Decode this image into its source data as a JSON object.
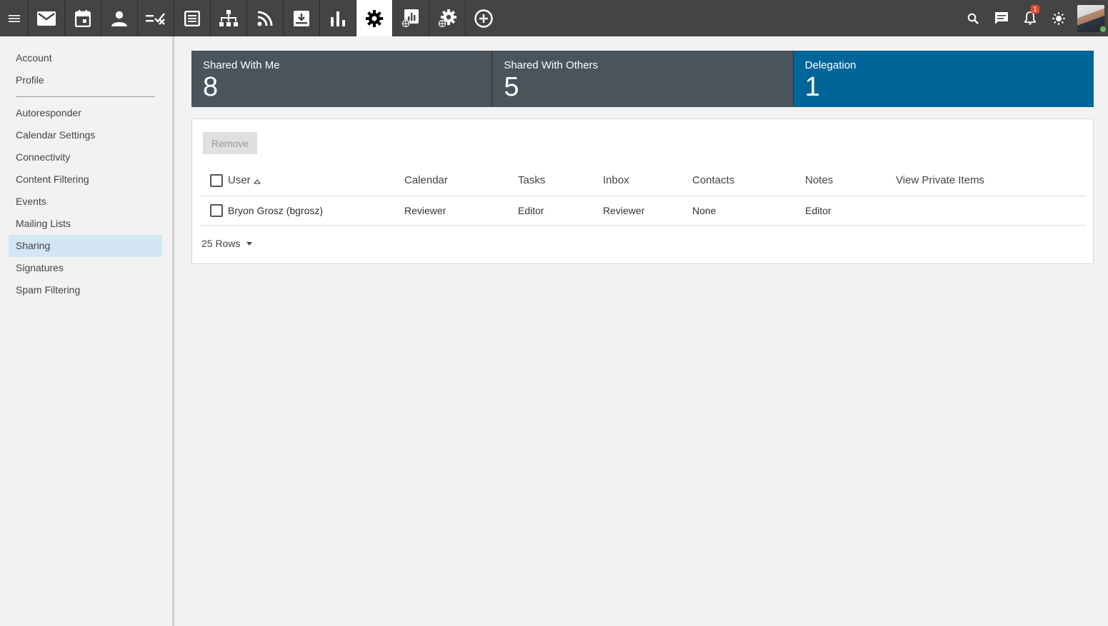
{
  "topbar": {
    "nav_icons": [
      "menu-icon",
      "mail-icon",
      "calendar-icon",
      "contacts-icon",
      "tasks-icon",
      "notes-icon",
      "org-chart-icon",
      "rss-icon",
      "file-storage-icon",
      "reports-icon",
      "settings-icon",
      "domain-reports-icon",
      "domain-settings-icon",
      "add-icon"
    ],
    "active": "settings-icon",
    "notification_count": "1"
  },
  "sidebar": {
    "group1": [
      {
        "label": "Account"
      },
      {
        "label": "Profile"
      }
    ],
    "group2": [
      {
        "label": "Autoresponder"
      },
      {
        "label": "Calendar Settings"
      },
      {
        "label": "Connectivity"
      },
      {
        "label": "Content Filtering"
      },
      {
        "label": "Events"
      },
      {
        "label": "Mailing Lists"
      },
      {
        "label": "Sharing"
      },
      {
        "label": "Signatures"
      },
      {
        "label": "Spam Filtering"
      }
    ],
    "active": "Sharing"
  },
  "cards": [
    {
      "title": "Shared With Me",
      "count": "8"
    },
    {
      "title": "Shared With Others",
      "count": "5"
    },
    {
      "title": "Delegation",
      "count": "1"
    }
  ],
  "toolbar": {
    "remove_label": "Remove"
  },
  "table": {
    "headers": {
      "user": "User",
      "calendar": "Calendar",
      "tasks": "Tasks",
      "inbox": "Inbox",
      "contacts": "Contacts",
      "notes": "Notes",
      "view_private": "View Private Items"
    },
    "rows": [
      {
        "user": "Bryon Grosz (bgrosz)",
        "calendar": "Reviewer",
        "tasks": "Editor",
        "inbox": "Reviewer",
        "contacts": "None",
        "notes": "Editor",
        "view_private": ""
      }
    ]
  },
  "pagination": {
    "rows_label": "25 Rows"
  },
  "colors": {
    "topbar": "#444444",
    "card": "#4a545c",
    "card_active": "#006699",
    "sidebar_active": "#d2e6f3",
    "badge": "#e8492e"
  }
}
